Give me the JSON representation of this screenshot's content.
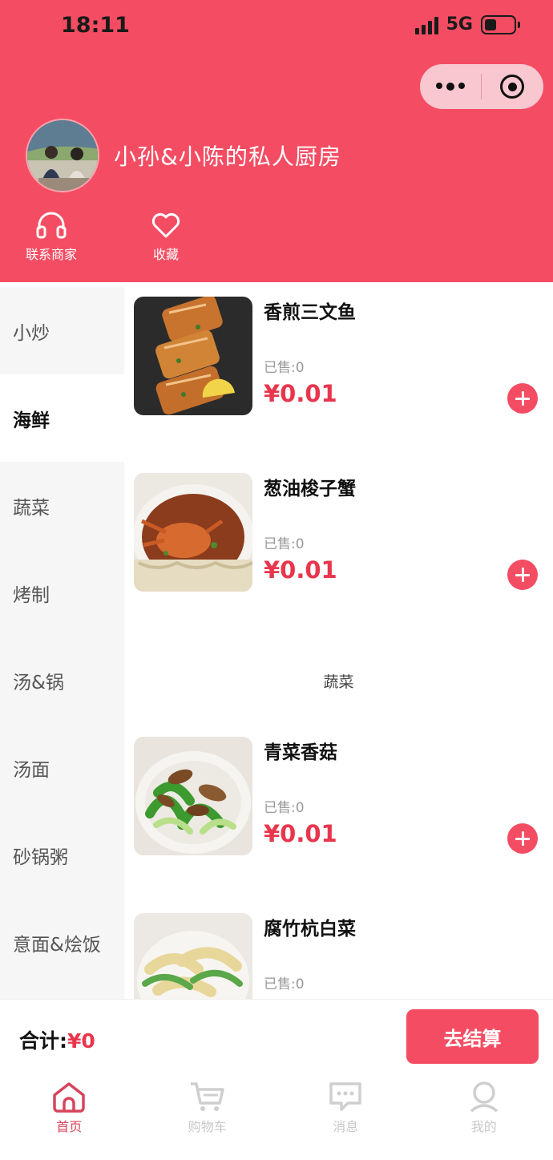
{
  "status_bar": {
    "time": "18:11",
    "network": "5G",
    "battery_level": 0.4
  },
  "header": {
    "shop_name": "小孙&小陈的私人厨房",
    "actions": [
      {
        "label": "联系商家",
        "icon": "headset-icon"
      },
      {
        "label": "收藏",
        "icon": "heart-icon"
      }
    ],
    "capsule": {
      "more_icon": "more-dots-icon",
      "close_icon": "target-icon"
    }
  },
  "categories": [
    {
      "label": "小炒"
    },
    {
      "label": "海鲜",
      "active": true
    },
    {
      "label": "蔬菜"
    },
    {
      "label": "烤制"
    },
    {
      "label": "汤&锅"
    },
    {
      "label": "汤面"
    },
    {
      "label": "砂锅粥"
    },
    {
      "label": "意面&烩饭"
    }
  ],
  "dishes": [
    {
      "name": "香煎三文鱼",
      "sold": "已售:0",
      "price": "¥0.01"
    },
    {
      "name": "葱油梭子蟹",
      "sold": "已售:0",
      "price": "¥0.01"
    },
    {
      "name": "青菜香菇",
      "sold": "已售:0",
      "price": "¥0.01"
    },
    {
      "name": "腐竹杭白菜",
      "sold": "已售:0",
      "price": ""
    }
  ],
  "section_label": "蔬菜",
  "cart": {
    "total_label": "合计:",
    "total_value": "¥0",
    "checkout_label": "去结算"
  },
  "tabbar": [
    {
      "label": "首页",
      "icon": "home-icon",
      "active": true
    },
    {
      "label": "购物车",
      "icon": "cart-icon"
    },
    {
      "label": "消息",
      "icon": "message-icon"
    },
    {
      "label": "我的",
      "icon": "user-icon"
    }
  ],
  "colors": {
    "brand": "#f44d63",
    "price": "#e8364d",
    "sidebar_bg": "#f6f6f6"
  }
}
